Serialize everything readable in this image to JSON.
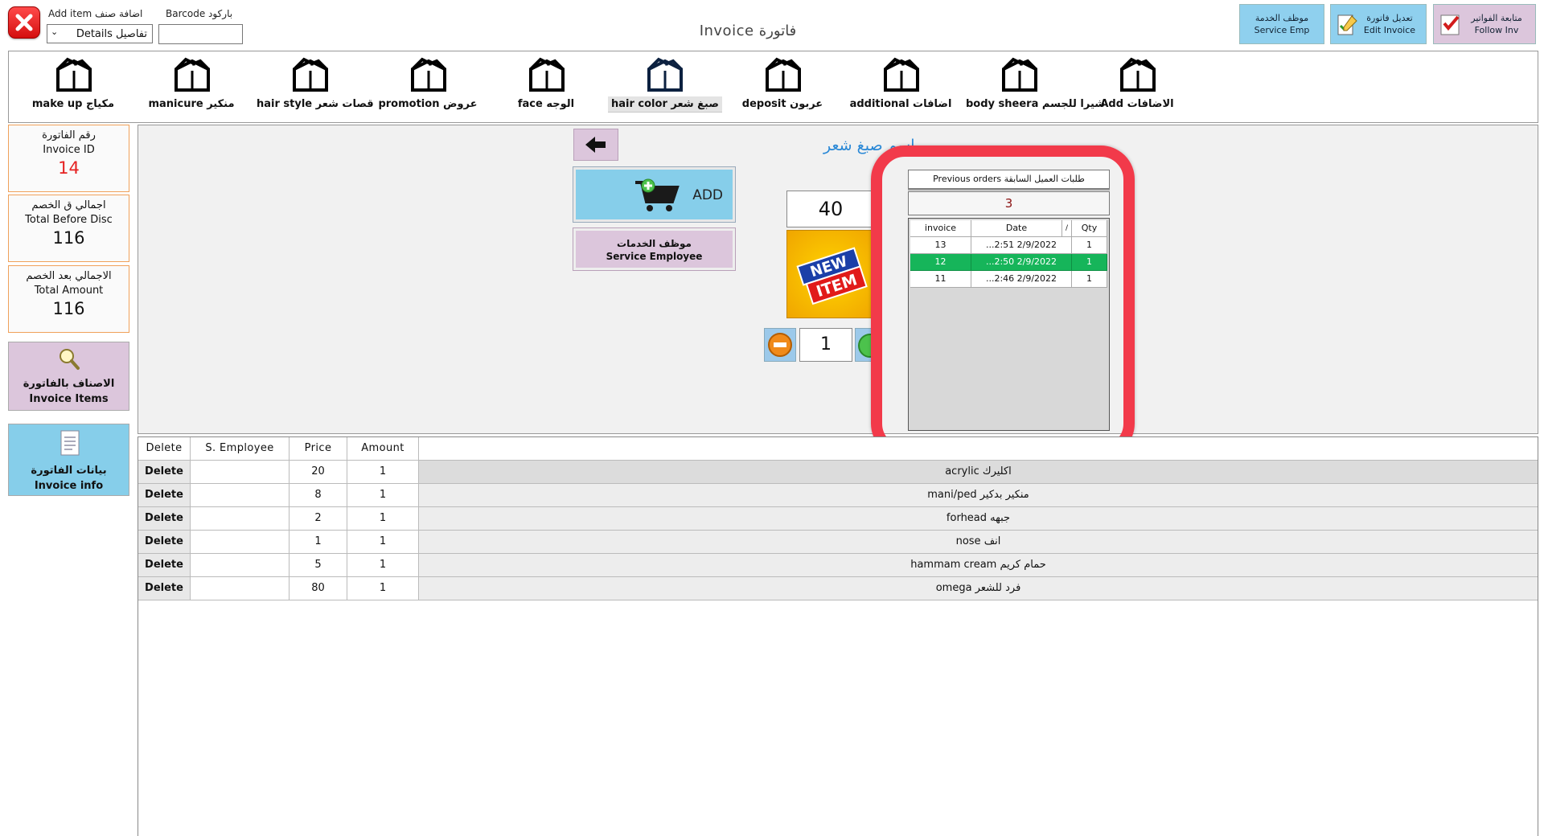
{
  "header": {
    "add_item_label": "Add item اضافة صنف",
    "barcode_label": "Barcode باركود",
    "details_select": "Details تفاصيل",
    "barcode_value": "",
    "title": "Invoice فاتورة"
  },
  "top_buttons": [
    {
      "line1": "موظف الخدمة",
      "line2": "Service Emp",
      "color": "#8fd0ee"
    },
    {
      "line1": "تعديل فاتورة",
      "line2": "Edit Invoice",
      "color": "#8fd0ee"
    },
    {
      "line1": "متابعة الفواتير",
      "line2": "Follow Inv",
      "color": "#dcc6dc"
    }
  ],
  "categories": [
    {
      "label": "make up مكياج"
    },
    {
      "label": "manicure منكير"
    },
    {
      "label": "hair style قصات شعر"
    },
    {
      "label": "promotion عروض"
    },
    {
      "label": "face الوجه"
    },
    {
      "label": "hair color صبغ شعر"
    },
    {
      "label": "deposit عربون"
    },
    {
      "label": "additional اضافات"
    },
    {
      "label": "body sheera شيرا للجسم"
    },
    {
      "label": "Add الاضافات"
    }
  ],
  "stats": {
    "invoice_id": {
      "ar": "رقم الفاتورة",
      "en": "Invoice ID",
      "value": "14"
    },
    "total_before": {
      "ar": "اجمالي ق الخصم",
      "en": "Total Before Disc",
      "value": "116"
    },
    "total_amount": {
      "ar": "الاجمالي بعد الخصم",
      "en": "Total Amount",
      "value": "116"
    }
  },
  "side_buttons": {
    "invoice_items": {
      "ar": "الاصناف بالفاتورة",
      "en": "Invoice Items"
    },
    "invoice_info": {
      "ar": "بيانات الفاتورة",
      "en": "Invoice info"
    }
  },
  "panel": {
    "service_title": "اسم صبغ شعر",
    "add_label": "ADD",
    "service_employee_ar": "موظف الخدمات",
    "service_employee_en": "Service Employee",
    "price": "40",
    "quantity": "1",
    "new_item_text_1": "NEW",
    "new_item_text_2": "ITEM"
  },
  "previous_orders": {
    "title": "Previous orders طلبات العميل السابقة",
    "count": "3",
    "headers": [
      "invoice",
      "Date",
      "/",
      "Qty"
    ],
    "rows": [
      {
        "invoice": "13",
        "date": "...2:51 2/9/2022",
        "qty": "1",
        "selected": false
      },
      {
        "invoice": "12",
        "date": "...2:50 2/9/2022",
        "qty": "1",
        "selected": true
      },
      {
        "invoice": "11",
        "date": "...2:46 2/9/2022",
        "qty": "1",
        "selected": false
      }
    ]
  },
  "table": {
    "headers": [
      "Delete",
      "S. Employee",
      "Price",
      "Amount",
      ""
    ],
    "rows": [
      {
        "delete": "Delete",
        "employee": "",
        "price": "20",
        "amount": "1",
        "desc": "acrylic اكليرك"
      },
      {
        "delete": "Delete",
        "employee": "",
        "price": "8",
        "amount": "1",
        "desc": "mani/ped منكير بدكير"
      },
      {
        "delete": "Delete",
        "employee": "",
        "price": "2",
        "amount": "1",
        "desc": "forhead جبهه"
      },
      {
        "delete": "Delete",
        "employee": "",
        "price": "1",
        "amount": "1",
        "desc": "nose انف"
      },
      {
        "delete": "Delete",
        "employee": "",
        "price": "5",
        "amount": "1",
        "desc": "hammam cream حمام كريم"
      },
      {
        "delete": "Delete",
        "employee": "",
        "price": "80",
        "amount": "1",
        "desc": "omega فرد للشعر"
      }
    ]
  },
  "colors": {
    "accent_red": "#f23a4a",
    "selected_green": "#16b55a",
    "blue_button": "#86ceea",
    "purple_button": "#dcc6dc"
  }
}
